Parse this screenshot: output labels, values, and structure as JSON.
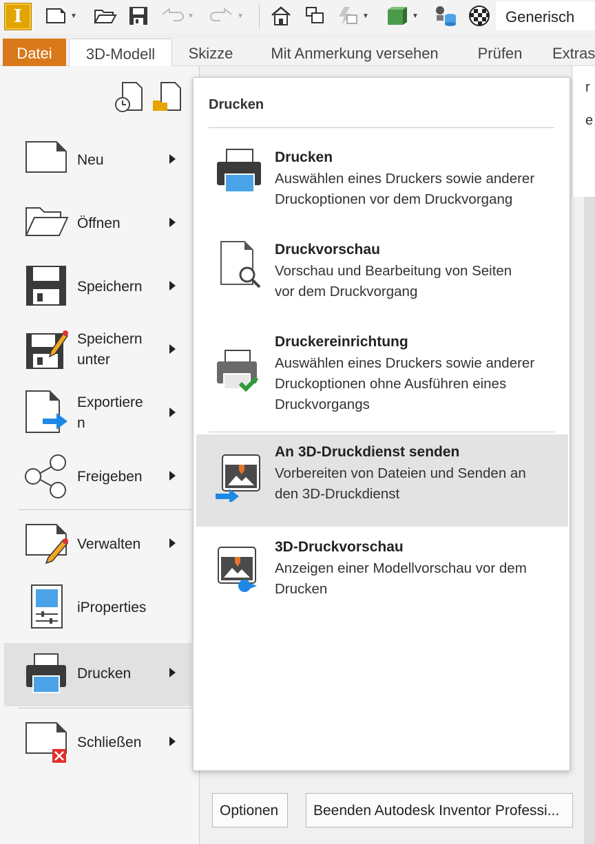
{
  "qat": {
    "logo_letter": "I",
    "workspace": "Generisch"
  },
  "tabs": [
    "Datei",
    "3D-Modell",
    "Skizze",
    "Mit Anmerkung versehen",
    "Prüfen",
    "Extras"
  ],
  "edge_chars": [
    "r",
    "e"
  ],
  "menu": {
    "items": [
      {
        "label": "Neu",
        "has_arrow": true
      },
      {
        "label": "Öffnen",
        "has_arrow": true
      },
      {
        "label": "Speichern",
        "has_arrow": true
      },
      {
        "label_lines": [
          "Speichern",
          "unter"
        ],
        "has_arrow": true
      },
      {
        "label_lines": [
          "Exportiere",
          "n"
        ],
        "has_arrow": true
      },
      {
        "label": "Freigeben",
        "has_arrow": true
      },
      {
        "label": "Verwalten",
        "has_arrow": true
      },
      {
        "label": "iProperties",
        "has_arrow": false
      },
      {
        "label": "Drucken",
        "has_arrow": true,
        "active": true
      },
      {
        "label": "Schließen",
        "has_arrow": true
      }
    ]
  },
  "flyout": {
    "title": "Drucken",
    "items": [
      {
        "title": "Drucken",
        "desc_lines": [
          "Auswählen eines Druckers sowie anderer",
          "Druckoptionen vor dem Druckvorgang"
        ],
        "icon": "printer-icon"
      },
      {
        "title": "Druckvorschau",
        "desc_lines": [
          "Vorschau und Bearbeitung von Seiten",
          "vor dem Druckvorgang"
        ],
        "icon": "print-preview-icon"
      },
      {
        "title": "Druckereinrichtung",
        "desc_lines": [
          "Auswählen eines Druckers sowie anderer",
          "Druckoptionen ohne Ausführen eines",
          "Druckvorgangs"
        ],
        "icon": "printer-setup-icon"
      },
      {
        "title": "An 3D-Druckdienst senden",
        "desc_lines": [
          "Vorbereiten von Dateien und Senden an",
          "den 3D-Druckdienst"
        ],
        "icon": "send-3d-print-icon",
        "highlight": true
      },
      {
        "title": "3D-Druckvorschau",
        "desc_lines": [
          "Anzeigen einer Modellvorschau vor dem",
          "Drucken"
        ],
        "icon": "3d-print-preview-icon"
      }
    ]
  },
  "bottom": {
    "options_label": "Optionen",
    "exit_label": "Beenden Autodesk Inventor Professi..."
  },
  "colors": {
    "accent_orange": "#d9791a",
    "highlight_gray": "#e1e1e1",
    "print_blue": "#4aa3e8"
  }
}
